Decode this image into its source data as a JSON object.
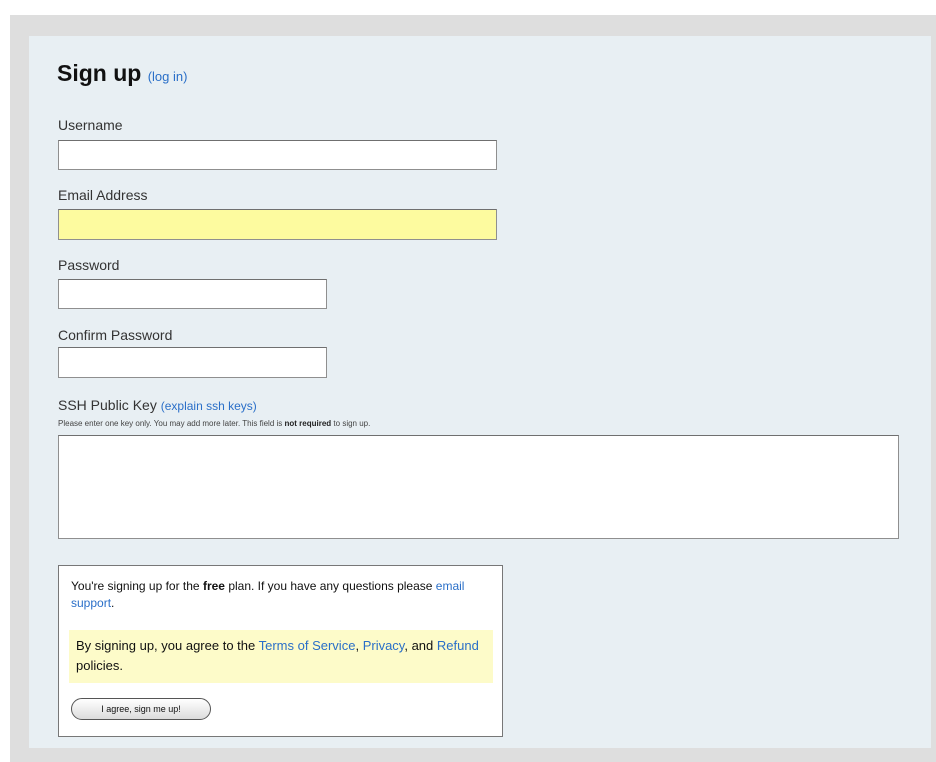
{
  "form": {
    "title": "Sign up",
    "login_link": "(log in)",
    "username": {
      "label": "Username",
      "value": ""
    },
    "email": {
      "label": "Email Address",
      "value": ""
    },
    "password": {
      "label": "Password",
      "value": ""
    },
    "confirm_password": {
      "label": "Confirm Password",
      "value": ""
    },
    "ssh_key": {
      "label": "SSH Public Key",
      "explain_link": "(explain ssh keys)",
      "hint_before": "Please enter one key only. You may add more later. This field is",
      "hint_bold": "not required",
      "hint_after": "to sign up.",
      "value": ""
    }
  },
  "agreement": {
    "plan_prefix": "You're signing up for the",
    "plan_name": "free",
    "plan_suffix": "plan. If you have any questions please",
    "support_link": "email support",
    "support_suffix": ".",
    "terms_prefix": "By signing up, you agree to the",
    "terms_link": "Terms of Service",
    "comma": ",",
    "privacy_link": "Privacy",
    "and_text": ", and",
    "refund_link": "Refund",
    "terms_suffix": "policies.",
    "submit_label": "I agree, sign me up!"
  },
  "colors": {
    "panel_background": "#e8eff3",
    "link": "#2a6fc8",
    "highlight_input": "#fdfb9f",
    "terms_background": "#fdfbc9"
  }
}
